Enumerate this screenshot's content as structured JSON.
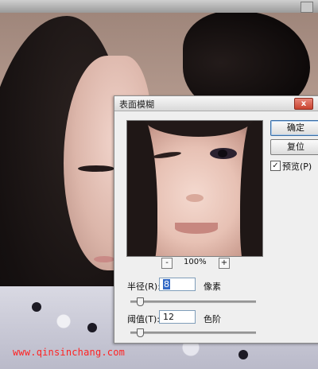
{
  "dialog": {
    "title": "表面模糊",
    "close_label": "x",
    "ok_label": "确定",
    "reset_label": "复位",
    "preview_checkbox": {
      "label": "预览(P)",
      "checked": true,
      "mark": "✓"
    },
    "zoom": {
      "minus": "-",
      "plus": "+",
      "value": "100%"
    },
    "radius": {
      "label": "半径(R):",
      "value": "8",
      "unit": "像素",
      "slider_position": 0.05
    },
    "threshold": {
      "label": "阈值(T):",
      "value": "12",
      "unit": "色阶",
      "slider_position": 0.05
    }
  },
  "watermark": "www.qinsinchang.com"
}
